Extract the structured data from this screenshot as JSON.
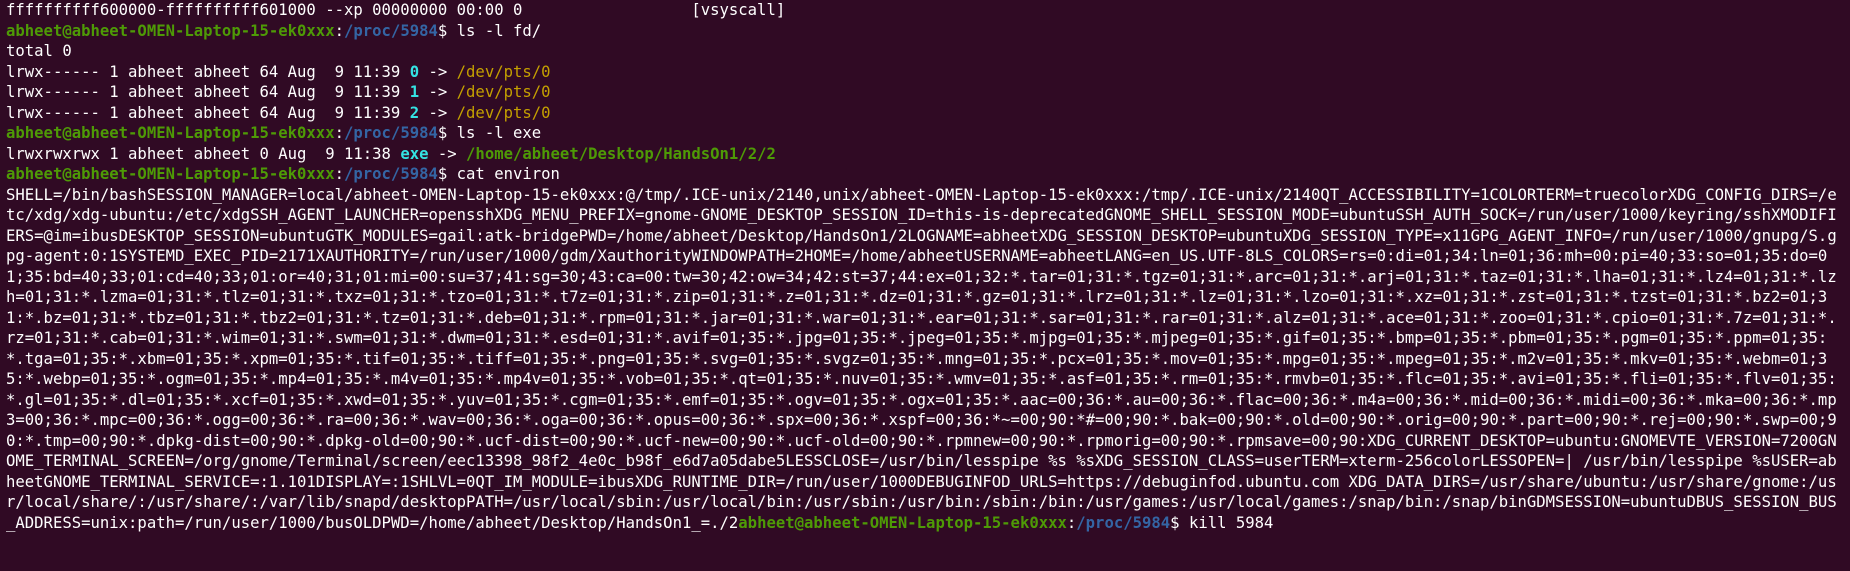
{
  "terminal": {
    "prompt_user": "abheet@abheet-OMEN-Laptop-15-ek0xxx",
    "prompt_path": "/proc/5984",
    "prompt_suffix": "$ ",
    "colon": ":",
    "vsyscall_line": "ffffffffff600000-ffffffffff601000 --xp 00000000 00:00 0                  [vsyscall]",
    "cmd1": "ls -l fd/",
    "total_line": "total 0",
    "fd_entries": [
      {
        "prefix": "lrwx------ 1 abheet abheet 64 Aug  9 11:39 ",
        "num": "0",
        "arrow": " -> ",
        "target": "/dev/pts/0"
      },
      {
        "prefix": "lrwx------ 1 abheet abheet 64 Aug  9 11:39 ",
        "num": "1",
        "arrow": " -> ",
        "target": "/dev/pts/0"
      },
      {
        "prefix": "lrwx------ 1 abheet abheet 64 Aug  9 11:39 ",
        "num": "2",
        "arrow": " -> ",
        "target": "/dev/pts/0"
      }
    ],
    "cmd2": "ls -l exe",
    "exe_entry": {
      "prefix": "lrwxrwxrwx 1 abheet abheet 0 Aug  9 11:38 ",
      "name": "exe",
      "arrow": " -> ",
      "target": "/home/abheet/Desktop/HandsOn1/2/2"
    },
    "cmd3": "cat environ",
    "environ_output": "SHELL=/bin/bashSESSION_MANAGER=local/abheet-OMEN-Laptop-15-ek0xxx:@/tmp/.ICE-unix/2140,unix/abheet-OMEN-Laptop-15-ek0xxx:/tmp/.ICE-unix/2140QT_ACCESSIBILITY=1COLORTERM=truecolorXDG_CONFIG_DIRS=/etc/xdg/xdg-ubuntu:/etc/xdgSSH_AGENT_LAUNCHER=opensshXDG_MENU_PREFIX=gnome-GNOME_DESKTOP_SESSION_ID=this-is-deprecatedGNOME_SHELL_SESSION_MODE=ubuntuSSH_AUTH_SOCK=/run/user/1000/keyring/sshXMODIFIERS=@im=ibusDESKTOP_SESSION=ubuntuGTK_MODULES=gail:atk-bridgePWD=/home/abheet/Desktop/HandsOn1/2LOGNAME=abheetXDG_SESSION_DESKTOP=ubuntuXDG_SESSION_TYPE=x11GPG_AGENT_INFO=/run/user/1000/gnupg/S.gpg-agent:0:1SYSTEMD_EXEC_PID=2171XAUTHORITY=/run/user/1000/gdm/XauthorityWINDOWPATH=2HOME=/home/abheetUSERNAME=abheetLANG=en_US.UTF-8LS_COLORS=rs=0:di=01;34:ln=01;36:mh=00:pi=40;33:so=01;35:do=01;35:bd=40;33;01:cd=40;33;01:or=40;31;01:mi=00:su=37;41:sg=30;43:ca=00:tw=30;42:ow=34;42:st=37;44:ex=01;32:*.tar=01;31:*.tgz=01;31:*.arc=01;31:*.arj=01;31:*.taz=01;31:*.lha=01;31:*.lz4=01;31:*.lzh=01;31:*.lzma=01;31:*.tlz=01;31:*.txz=01;31:*.tzo=01;31:*.t7z=01;31:*.zip=01;31:*.z=01;31:*.dz=01;31:*.gz=01;31:*.lrz=01;31:*.lz=01;31:*.lzo=01;31:*.xz=01;31:*.zst=01;31:*.tzst=01;31:*.bz2=01;31:*.bz=01;31:*.tbz=01;31:*.tbz2=01;31:*.tz=01;31:*.deb=01;31:*.rpm=01;31:*.jar=01;31:*.war=01;31:*.ear=01;31:*.sar=01;31:*.rar=01;31:*.alz=01;31:*.ace=01;31:*.zoo=01;31:*.cpio=01;31:*.7z=01;31:*.rz=01;31:*.cab=01;31:*.wim=01;31:*.swm=01;31:*.dwm=01;31:*.esd=01;31:*.avif=01;35:*.jpg=01;35:*.jpeg=01;35:*.mjpg=01;35:*.mjpeg=01;35:*.gif=01;35:*.bmp=01;35:*.pbm=01;35:*.pgm=01;35:*.ppm=01;35:*.tga=01;35:*.xbm=01;35:*.xpm=01;35:*.tif=01;35:*.tiff=01;35:*.png=01;35:*.svg=01;35:*.svgz=01;35:*.mng=01;35:*.pcx=01;35:*.mov=01;35:*.mpg=01;35:*.mpeg=01;35:*.m2v=01;35:*.mkv=01;35:*.webm=01;35:*.webp=01;35:*.ogm=01;35:*.mp4=01;35:*.m4v=01;35:*.mp4v=01;35:*.vob=01;35:*.qt=01;35:*.nuv=01;35:*.wmv=01;35:*.asf=01;35:*.rm=01;35:*.rmvb=01;35:*.flc=01;35:*.avi=01;35:*.fli=01;35:*.flv=01;35:*.gl=01;35:*.dl=01;35:*.xcf=01;35:*.xwd=01;35:*.yuv=01;35:*.cgm=01;35:*.emf=01;35:*.ogv=01;35:*.ogx=01;35:*.aac=00;36:*.au=00;36:*.flac=00;36:*.m4a=00;36:*.mid=00;36:*.midi=00;36:*.mka=00;36:*.mp3=00;36:*.mpc=00;36:*.ogg=00;36:*.ra=00;36:*.wav=00;36:*.oga=00;36:*.opus=00;36:*.spx=00;36:*.xspf=00;36:*~=00;90:*#=00;90:*.bak=00;90:*.old=00;90:*.orig=00;90:*.part=00;90:*.rej=00;90:*.swp=00;90:*.tmp=00;90:*.dpkg-dist=00;90:*.dpkg-old=00;90:*.ucf-dist=00;90:*.ucf-new=00;90:*.ucf-old=00;90:*.rpmnew=00;90:*.rpmorig=00;90:*.rpmsave=00;90:XDG_CURRENT_DESKTOP=ubuntu:GNOMEVTE_VERSION=7200GNOME_TERMINAL_SCREEN=/org/gnome/Terminal/screen/eec13398_98f2_4e0c_b98f_e6d7a05dabe5LESSCLOSE=/usr/bin/lesspipe %s %sXDG_SESSION_CLASS=userTERM=xterm-256colorLESSOPEN=| /usr/bin/lesspipe %sUSER=abheetGNOME_TERMINAL_SERVICE=:1.101DISPLAY=:1SHLVL=0QT_IM_MODULE=ibusXDG_RUNTIME_DIR=/run/user/1000DEBUGINFOD_URLS=https://debuginfod.ubuntu.com XDG_DATA_DIRS=/usr/share/ubuntu:/usr/share/gnome:/usr/local/share/:/usr/share/:/var/lib/snapd/desktopPATH=/usr/local/sbin:/usr/local/bin:/usr/sbin:/usr/bin:/sbin:/bin:/usr/games:/usr/local/games:/snap/bin:/snap/binGDMSESSION=ubuntuDBUS_SESSION_BUS_ADDRESS=unix:path=/run/user/1000/busOLDPWD=/home/abheet/Desktop/HandsOn1_=./2",
    "cmd4": "kill 5984",
    "colors": {
      "background": "#300a24",
      "foreground": "#ffffff",
      "user": "#4e9a06",
      "path": "#3465a4",
      "fd_number": "#34e2e2",
      "symlink_target": "#c4a000"
    }
  }
}
